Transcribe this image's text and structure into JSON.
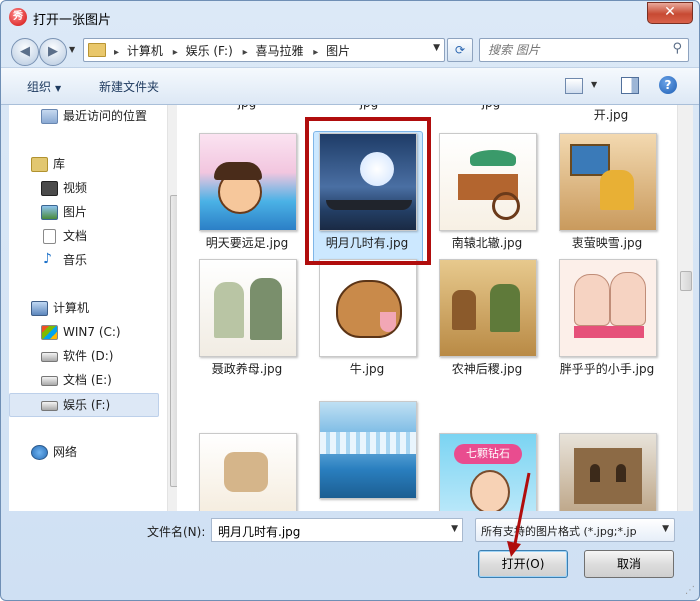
{
  "window": {
    "title": "打开一张图片",
    "app_icon_glyph": "秀",
    "close_glyph": "✕"
  },
  "address": {
    "path": [
      "计算机",
      "娱乐 (F:)",
      "喜马拉雅",
      "图片"
    ],
    "separator": "▸"
  },
  "search": {
    "placeholder": "搜索 图片"
  },
  "toolbar": {
    "organize_label": "组织",
    "new_folder_label": "新建文件夹"
  },
  "sidebar": {
    "items": [
      {
        "label": "最近访问的位置",
        "icon": "recent-places-icon"
      },
      {
        "label": "库",
        "icon": "library-icon"
      },
      {
        "label": "视频",
        "icon": "video-icon"
      },
      {
        "label": "图片",
        "icon": "pictures-icon"
      },
      {
        "label": "文档",
        "icon": "document-icon"
      },
      {
        "label": "音乐",
        "icon": "music-icon"
      },
      {
        "label": "计算机",
        "icon": "computer-icon"
      },
      {
        "label": "WIN7 (C:)",
        "icon": "windows-drive-icon"
      },
      {
        "label": "软件 (D:)",
        "icon": "drive-icon"
      },
      {
        "label": "文档 (E:)",
        "icon": "drive-icon"
      },
      {
        "label": "娱乐 (F:)",
        "icon": "drive-icon"
      },
      {
        "label": "网络",
        "icon": "network-icon"
      }
    ],
    "selected": "娱乐 (F:)"
  },
  "files": {
    "top_partial": [
      "jpg",
      "jpg",
      "jpg",
      "开.jpg"
    ],
    "rows": [
      [
        {
          "name": "明天要远足.jpg"
        },
        {
          "name": "明月几时有.jpg",
          "selected": true
        },
        {
          "name": "南辕北辙.jpg"
        },
        {
          "name": "衷萤映雪.jpg"
        }
      ],
      [
        {
          "name": "聂政养母.jpg"
        },
        {
          "name": "牛.jpg"
        },
        {
          "name": "农神后稷.jpg"
        },
        {
          "name": "胖乎乎的小手.jpg"
        }
      ],
      [
        {
          "name": ""
        },
        {
          "name": ""
        },
        {
          "name": ""
        },
        {
          "name": ""
        }
      ]
    ],
    "thumb_text_qikezuanshi": "七颗钻石"
  },
  "bottom": {
    "filename_label": "文件名(N):",
    "filename_value": "明月几时有.jpg",
    "filter_value": "所有支持的图片格式 (*.jpg;*.jp",
    "open_label": "打开(O)",
    "cancel_label": "取消"
  },
  "colors": {
    "highlight_box": "#b00d0d",
    "selection_bg": "#cce8ff"
  }
}
